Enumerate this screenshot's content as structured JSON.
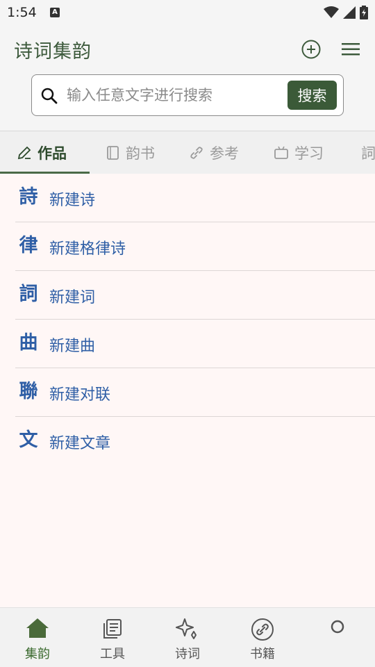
{
  "status_bar": {
    "time": "1:54",
    "notification_letter": "A"
  },
  "app_bar": {
    "title": "诗词集韵"
  },
  "search": {
    "placeholder": "输入任意文字进行搜索",
    "value": "",
    "button_label": "搜索"
  },
  "tabs": [
    {
      "label": "作品",
      "icon": "pencil-icon",
      "active": true
    },
    {
      "label": "韵书",
      "icon": "book-icon",
      "active": false
    },
    {
      "label": "参考",
      "icon": "link-icon",
      "active": false
    },
    {
      "label": "学习",
      "icon": "tv-icon",
      "active": false
    },
    {
      "label": "詞",
      "icon": "partial-tab",
      "active": false
    }
  ],
  "list": [
    {
      "glyph": "詩",
      "label": "新建诗"
    },
    {
      "glyph": "律",
      "label": "新建格律诗"
    },
    {
      "glyph": "詞",
      "label": "新建词"
    },
    {
      "glyph": "曲",
      "label": "新建曲"
    },
    {
      "glyph": "聯",
      "label": "新建对联"
    },
    {
      "glyph": "文",
      "label": "新建文章"
    }
  ],
  "bottom_nav": [
    {
      "label": "集韵",
      "icon": "home-icon",
      "active": true
    },
    {
      "label": "工具",
      "icon": "notes-icon",
      "active": false
    },
    {
      "label": "诗词",
      "icon": "sparkle-icon",
      "active": false
    },
    {
      "label": "书籍",
      "icon": "link-circle-icon",
      "active": false
    },
    {
      "label": "",
      "icon": "circle-icon",
      "active": false
    }
  ],
  "colors": {
    "accent": "#3b5a38",
    "list_text": "#2f5fa6",
    "list_bg": "#fff7f6"
  }
}
